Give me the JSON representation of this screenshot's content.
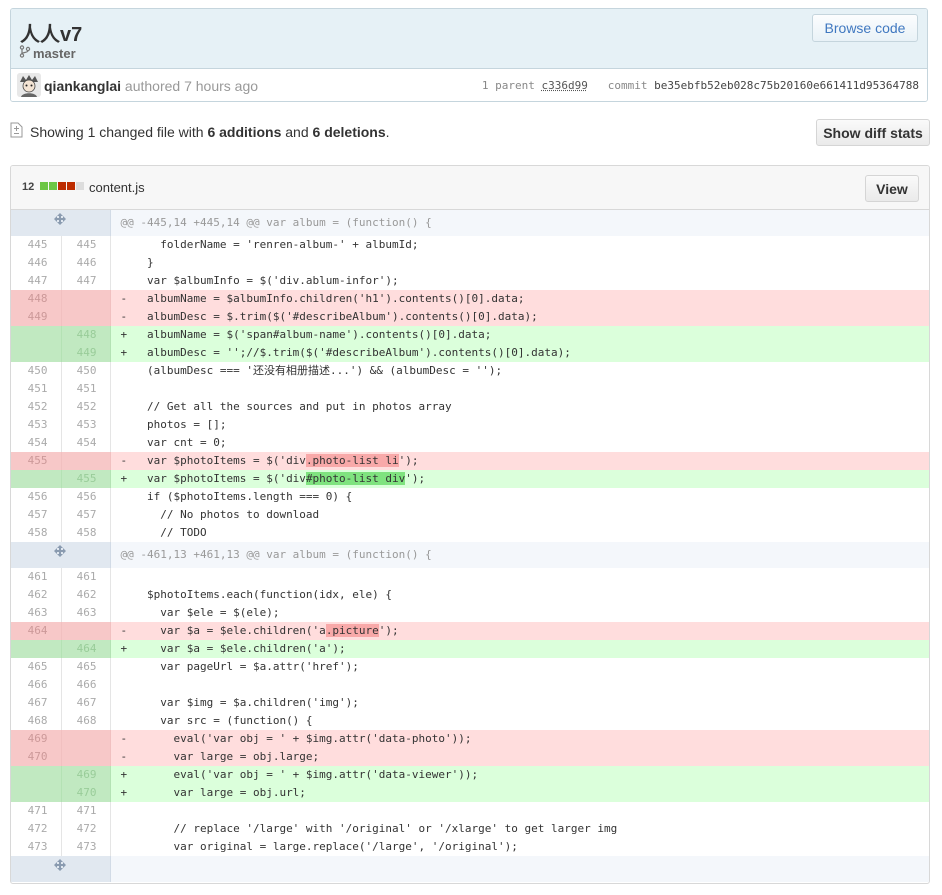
{
  "commit": {
    "title": "人人v7",
    "branch": "master",
    "browse_label": "Browse code",
    "author": "qiankanglai",
    "authored_text": "authored 7 hours ago",
    "parent_label": "1 parent",
    "parent_sha": "c336d99",
    "commit_label": "commit",
    "commit_sha": "be35ebfb52eb028c75b20160e661411d95364788"
  },
  "toc": {
    "prefix": "Showing ",
    "changed": "1 changed file",
    "with": " with ",
    "additions": "6 additions",
    "and": " and ",
    "deletions": "6 deletions",
    "suffix": ".",
    "diffstat_label": "Show diff stats"
  },
  "file": {
    "change_count": "12",
    "name": "content.js",
    "view_label": "View",
    "stat_colors": [
      "#6cc644",
      "#6cc644",
      "#bd2c00",
      "#bd2c00",
      "#dddddd"
    ]
  },
  "hunks": [
    {
      "header": "@@ -445,14 +445,14 @@ var album = (function() {",
      "lines": [
        {
          "t": "ctx",
          "o": "445",
          "n": "445",
          "c": "      folderName = 'renren-album-' + albumId;"
        },
        {
          "t": "ctx",
          "o": "446",
          "n": "446",
          "c": "    }"
        },
        {
          "t": "ctx",
          "o": "447",
          "n": "447",
          "c": "    var $albumInfo = $('div.ablum-infor');"
        },
        {
          "t": "del",
          "o": "448",
          "n": "",
          "c": "-   albumName = $albumInfo.children('h1').contents()[0].data;"
        },
        {
          "t": "del",
          "o": "449",
          "n": "",
          "c": "-   albumDesc = $.trim($('#describeAlbum').contents()[0].data);"
        },
        {
          "t": "add",
          "o": "",
          "n": "448",
          "c": "+   albumName = $('span#album-name').contents()[0].data;"
        },
        {
          "t": "add",
          "o": "",
          "n": "449",
          "c": "+   albumDesc = '';//$.trim($('#describeAlbum').contents()[0].data);"
        },
        {
          "t": "ctx",
          "o": "450",
          "n": "450",
          "c": "    (albumDesc === '还没有相册描述...') && (albumDesc = '');"
        },
        {
          "t": "ctx",
          "o": "451",
          "n": "451",
          "c": ""
        },
        {
          "t": "ctx",
          "o": "452",
          "n": "452",
          "c": "    // Get all the sources and put in photos array"
        },
        {
          "t": "ctx",
          "o": "453",
          "n": "453",
          "c": "    photos = [];"
        },
        {
          "t": "ctx",
          "o": "454",
          "n": "454",
          "c": "    var cnt = 0;"
        },
        {
          "t": "del",
          "o": "455",
          "n": "",
          "c": "-   var $photoItems = $('div",
          "hl": ".photo-list li",
          "c2": "');"
        },
        {
          "t": "add",
          "o": "",
          "n": "455",
          "c": "+   var $photoItems = $('div",
          "hl": "#photo-list div",
          "c2": "');"
        },
        {
          "t": "ctx",
          "o": "456",
          "n": "456",
          "c": "    if ($photoItems.length === 0) {"
        },
        {
          "t": "ctx",
          "o": "457",
          "n": "457",
          "c": "      // No photos to download"
        },
        {
          "t": "ctx",
          "o": "458",
          "n": "458",
          "c": "      // TODO"
        }
      ]
    },
    {
      "header": "@@ -461,13 +461,13 @@ var album = (function() {",
      "lines": [
        {
          "t": "ctx",
          "o": "461",
          "n": "461",
          "c": ""
        },
        {
          "t": "ctx",
          "o": "462",
          "n": "462",
          "c": "    $photoItems.each(function(idx, ele) {"
        },
        {
          "t": "ctx",
          "o": "463",
          "n": "463",
          "c": "      var $ele = $(ele);"
        },
        {
          "t": "del",
          "o": "464",
          "n": "",
          "c": "-     var $a = $ele.children('a",
          "hl": ".picture",
          "c2": "');"
        },
        {
          "t": "add",
          "o": "",
          "n": "464",
          "c": "+     var $a = $ele.children('a');"
        },
        {
          "t": "ctx",
          "o": "465",
          "n": "465",
          "c": "      var pageUrl = $a.attr('href');"
        },
        {
          "t": "ctx",
          "o": "466",
          "n": "466",
          "c": ""
        },
        {
          "t": "ctx",
          "o": "467",
          "n": "467",
          "c": "      var $img = $a.children('img');"
        },
        {
          "t": "ctx",
          "o": "468",
          "n": "468",
          "c": "      var src = (function() {"
        },
        {
          "t": "del",
          "o": "469",
          "n": "",
          "c": "-       eval('var obj = ' + $img.attr('data-photo'));"
        },
        {
          "t": "del",
          "o": "470",
          "n": "",
          "c": "-       var large = obj.large;"
        },
        {
          "t": "add",
          "o": "",
          "n": "469",
          "c": "+       eval('var obj = ' + $img.attr('data-viewer'));"
        },
        {
          "t": "add",
          "o": "",
          "n": "470",
          "c": "+       var large = obj.url;"
        },
        {
          "t": "ctx",
          "o": "471",
          "n": "471",
          "c": ""
        },
        {
          "t": "ctx",
          "o": "472",
          "n": "472",
          "c": "        // replace '/large' with '/original' or '/xlarge' to get larger img"
        },
        {
          "t": "ctx",
          "o": "473",
          "n": "473",
          "c": "        var original = large.replace('/large', '/original');"
        }
      ]
    },
    {
      "header": "",
      "lines": []
    }
  ]
}
